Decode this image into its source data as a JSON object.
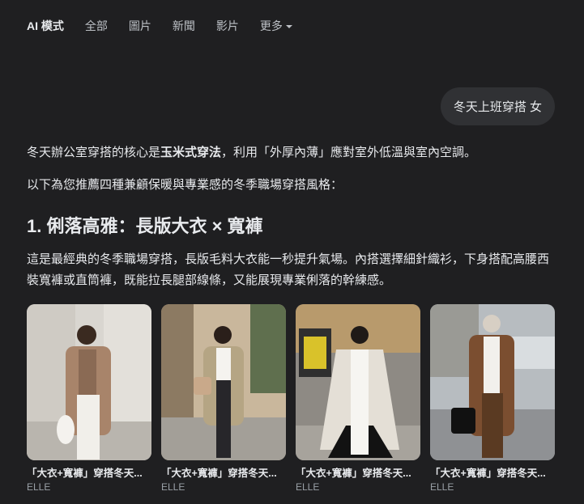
{
  "tabs": [
    {
      "label": "AI 模式",
      "active": true
    },
    {
      "label": "全部"
    },
    {
      "label": "圖片"
    },
    {
      "label": "新聞"
    },
    {
      "label": "影片"
    },
    {
      "label": "更多",
      "has_dropdown": true
    }
  ],
  "query": "冬天上班穿搭 女",
  "intro": {
    "prefix": "冬天辦公室穿搭的核心是",
    "bold": "玉米式穿法",
    "suffix": "，利用「外厚內薄」應對室外低溫與室內空調。"
  },
  "lead": "以下為您推薦四種兼顧保暖與專業感的冬季職場穿搭風格：",
  "section_title": "1. 俐落高雅：長版大衣 × 寬褲",
  "section_body": "這是最經典的冬季職場穿搭，長版毛料大衣能一秒提升氣場。內搭選擇細針織衫，下身搭配高腰西裝寬褲或直筒褲，既能拉長腿部線條，又能展現專業俐落的幹練感。",
  "images": [
    {
      "title": "「大衣+寬褲」穿搭冬天...",
      "source": "ELLE"
    },
    {
      "title": "「大衣+寬褲」穿搭冬天...",
      "source": "ELLE"
    },
    {
      "title": "「大衣+寬褲」穿搭冬天...",
      "source": "ELLE"
    },
    {
      "title": "「大衣+寬褲」穿搭冬天...",
      "source": "ELLE"
    }
  ]
}
